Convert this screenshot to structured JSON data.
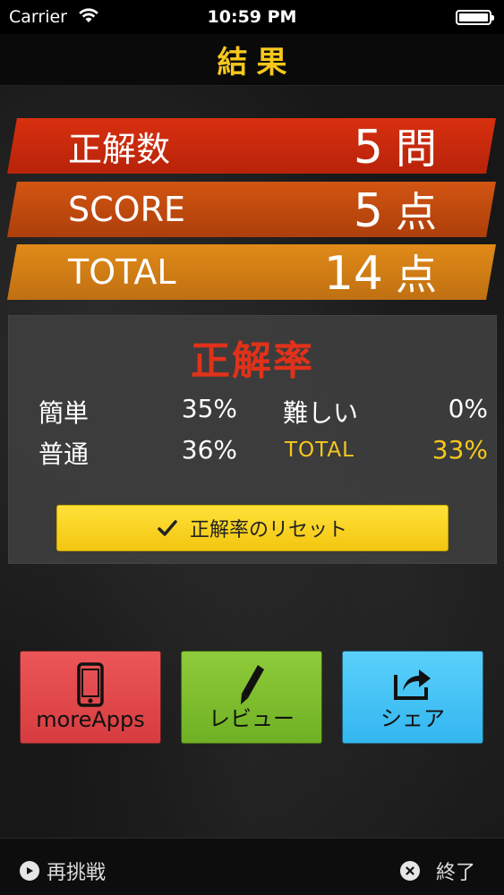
{
  "status_bar": {
    "carrier": "Carrier",
    "time": "10:59 PM"
  },
  "header": {
    "title": "結果"
  },
  "results": [
    {
      "label": "正解数",
      "value": "5",
      "unit": "問"
    },
    {
      "label": "SCORE",
      "value": "5",
      "unit": "点"
    },
    {
      "label": "TOTAL",
      "value": "14",
      "unit": "点"
    }
  ],
  "accuracy": {
    "title": "正解率",
    "easy_label": "簡単",
    "easy_value": "35%",
    "hard_label": "難しい",
    "hard_value": "0%",
    "normal_label": "普通",
    "normal_value": "36%",
    "total_label": "TOTAL",
    "total_value": "33%",
    "reset_label": "正解率のリセット"
  },
  "buttons": {
    "more_apps": "moreApps",
    "review": "レビュー",
    "share": "シェア"
  },
  "bottom": {
    "retry": "再挑戦",
    "quit": "終了"
  },
  "colors": {
    "accent_yellow": "#f6c81c",
    "red_title": "#e0321a",
    "banner1": "#d7300f",
    "banner2": "#d25512",
    "banner3": "#e08a18",
    "more_apps_btn": "#e64a4d",
    "review_btn": "#7fbe2f",
    "share_btn": "#45c3f5"
  },
  "icons": {
    "wifi": "wifi-icon",
    "battery": "battery-icon",
    "check": "check-icon",
    "phone": "phone-icon",
    "pencil": "pencil-icon",
    "share": "share-icon",
    "play": "play-icon",
    "close": "close-icon"
  }
}
